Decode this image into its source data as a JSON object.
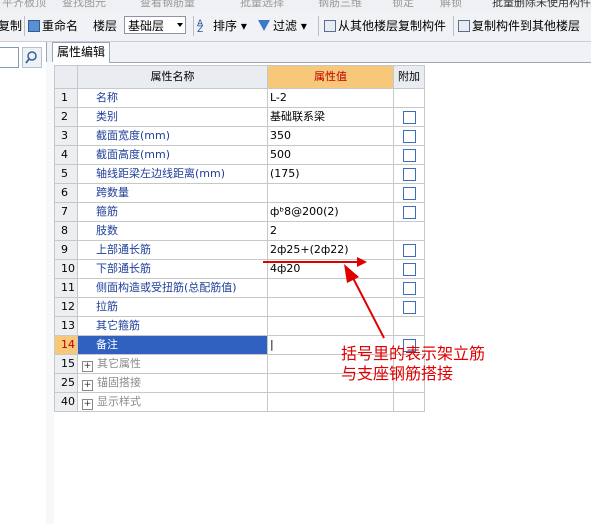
{
  "toolbar_top": {
    "items": [
      "平齐板顶",
      "查找图元",
      "查看钢筋量",
      "批量选择",
      "钢筋三维",
      "锁定",
      "解锁",
      "批量删除未使用构件"
    ]
  },
  "toolbar": {
    "copy": "复制",
    "rename": "重命名",
    "floor_label": "楼层",
    "floor_value": "基础层",
    "sort": "排序",
    "filter": "过滤",
    "copy_from_floor": "从其他楼层复制构件",
    "copy_to_floor": "复制构件到其他楼层"
  },
  "tab": "属性编辑",
  "grid": {
    "headers": {
      "name": "属性名称",
      "value": "属性值",
      "extra": "附加"
    },
    "rows": [
      {
        "num": "1",
        "name": "名称",
        "value": "L-2",
        "check": false
      },
      {
        "num": "2",
        "name": "类别",
        "value": "基础联系梁",
        "check": true
      },
      {
        "num": "3",
        "name": "截面宽度(mm)",
        "value": "350",
        "check": true
      },
      {
        "num": "4",
        "name": "截面高度(mm)",
        "value": "500",
        "check": true
      },
      {
        "num": "5",
        "name": "轴线距梁左边线距离(mm)",
        "value": "(175)",
        "check": true
      },
      {
        "num": "6",
        "name": "跨数量",
        "value": "",
        "check": true
      },
      {
        "num": "7",
        "name": "箍筋",
        "value": "фᵇ8@200(2)",
        "check": true
      },
      {
        "num": "8",
        "name": "肢数",
        "value": "2",
        "check": false
      },
      {
        "num": "9",
        "name": "上部通长筋",
        "value": "2ф25+(2ф22)",
        "check": true
      },
      {
        "num": "10",
        "name": "下部通长筋",
        "value": "4ф20",
        "check": true
      },
      {
        "num": "11",
        "name": "侧面构造或受扭筋(总配筋值)",
        "value": "",
        "check": true
      },
      {
        "num": "12",
        "name": "拉筋",
        "value": "",
        "check": true
      },
      {
        "num": "13",
        "name": "其它箍筋",
        "value": "",
        "check": false
      },
      {
        "num": "14",
        "name": "备注",
        "value": "|",
        "check": true,
        "selected": true
      },
      {
        "num": "15",
        "name": "其它属性",
        "value": "",
        "check": false,
        "group": true
      },
      {
        "num": "25",
        "name": "锚固搭接",
        "value": "",
        "check": false,
        "group": true
      },
      {
        "num": "40",
        "name": "显示样式",
        "value": "",
        "check": false,
        "group": true
      }
    ]
  },
  "annotation": {
    "line1": "括号里的表示架立筋",
    "line2": "与支座钢筋搭接"
  },
  "colors": {
    "accent": "#f7c77a",
    "selection": "#3060c0",
    "annotation": "#e00000"
  }
}
